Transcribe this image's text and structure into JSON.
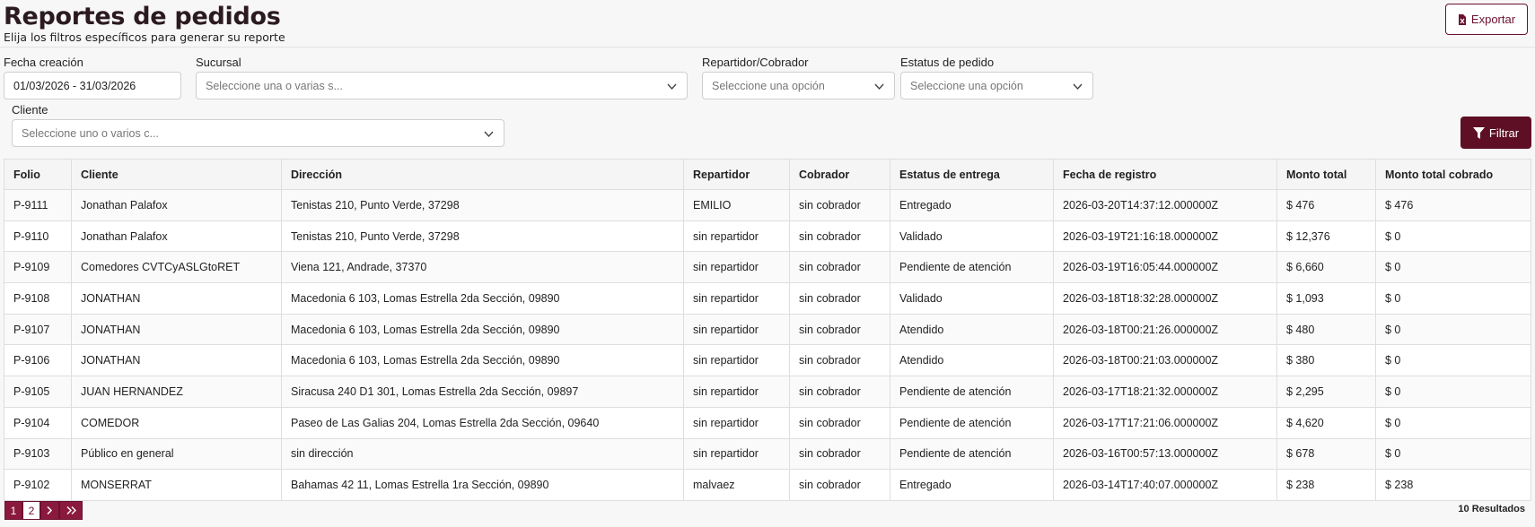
{
  "header": {
    "title": "Reportes de pedidos",
    "subtitle": "Elija los filtros específicos para generar su reporte",
    "export_label": "Exportar"
  },
  "filters": {
    "fecha": {
      "label": "Fecha creación",
      "value": "01/03/2026 - 31/03/2026"
    },
    "sucursal": {
      "label": "Sucursal",
      "placeholder": "Seleccione una o varias s..."
    },
    "repartidor": {
      "label": "Repartidor/Cobrador",
      "placeholder": "Seleccione una opción"
    },
    "estatus": {
      "label": "Estatus de pedido",
      "placeholder": "Seleccione una opción"
    },
    "cliente": {
      "label": "Cliente",
      "placeholder": "Seleccione uno o varios c..."
    },
    "filter_label": "Filtrar"
  },
  "table": {
    "columns": [
      "Folio",
      "Cliente",
      "Dirección",
      "Repartidor",
      "Cobrador",
      "Estatus de entrega",
      "Fecha de registro",
      "Monto total",
      "Monto total cobrado"
    ],
    "rows": [
      [
        "P-9111",
        "Jonathan Palafox",
        "Tenistas 210, Punto Verde, 37298",
        "EMILIO",
        "sin cobrador",
        "Entregado",
        "2026-03-20T14:37:12.000000Z",
        "$ 476",
        "$ 476"
      ],
      [
        "P-9110",
        "Jonathan Palafox",
        "Tenistas 210, Punto Verde, 37298",
        "sin repartidor",
        "sin cobrador",
        "Validado",
        "2026-03-19T21:16:18.000000Z",
        "$ 12,376",
        "$ 0"
      ],
      [
        "P-9109",
        "Comedores CVTCyASLGtoRET",
        "Viena 121, Andrade, 37370",
        "sin repartidor",
        "sin cobrador",
        "Pendiente de atención",
        "2026-03-19T16:05:44.000000Z",
        "$ 6,660",
        "$ 0"
      ],
      [
        "P-9108",
        "JONATHAN",
        "Macedonia 6 103, Lomas Estrella 2da Sección, 09890",
        "sin repartidor",
        "sin cobrador",
        "Validado",
        "2026-03-18T18:32:28.000000Z",
        "$ 1,093",
        "$ 0"
      ],
      [
        "P-9107",
        "JONATHAN",
        "Macedonia 6 103, Lomas Estrella 2da Sección, 09890",
        "sin repartidor",
        "sin cobrador",
        "Atendido",
        "2026-03-18T00:21:26.000000Z",
        "$ 480",
        "$ 0"
      ],
      [
        "P-9106",
        "JONATHAN",
        "Macedonia 6 103, Lomas Estrella 2da Sección, 09890",
        "sin repartidor",
        "sin cobrador",
        "Atendido",
        "2026-03-18T00:21:03.000000Z",
        "$ 380",
        "$ 0"
      ],
      [
        "P-9105",
        "JUAN HERNANDEZ",
        "Siracusa 240 D1 301, Lomas Estrella 2da Sección, 09897",
        "sin repartidor",
        "sin cobrador",
        "Pendiente de atención",
        "2026-03-17T18:21:32.000000Z",
        "$ 2,295",
        "$ 0"
      ],
      [
        "P-9104",
        "COMEDOR",
        "Paseo de Las Galias 204, Lomas Estrella 2da Sección, 09640",
        "sin repartidor",
        "sin cobrador",
        "Pendiente de atención",
        "2026-03-17T17:21:06.000000Z",
        "$ 4,620",
        "$ 0"
      ],
      [
        "P-9103",
        "Público en general",
        "sin dirección",
        "sin repartidor",
        "sin cobrador",
        "Pendiente de atención",
        "2026-03-16T00:57:13.000000Z",
        "$ 678",
        "$ 0"
      ],
      [
        "P-9102",
        "MONSERRAT",
        "Bahamas 42 11, Lomas Estrella 1ra Sección, 09890",
        "malvaez",
        "sin cobrador",
        "Entregado",
        "2026-03-14T17:40:07.000000Z",
        "$ 238",
        "$ 238"
      ]
    ]
  },
  "pagination": {
    "pages": [
      "1",
      "2"
    ],
    "current": "1",
    "results_text": "10 Resultados"
  },
  "colors": {
    "accent": "#5e0f26",
    "accent_light": "#8a1a3d"
  },
  "icons": [
    "file-excel-icon",
    "chevron-down-icon",
    "filter-icon",
    "chevron-right-icon",
    "double-chevron-right-icon"
  ]
}
